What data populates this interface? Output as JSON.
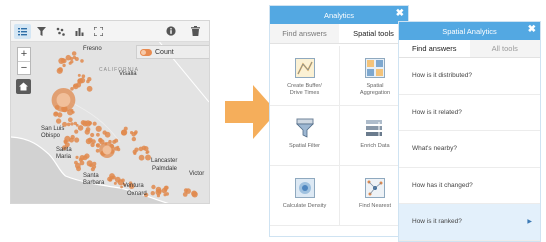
{
  "map": {
    "toolbar_icons": [
      "list-icon",
      "filter-icon",
      "scatter-icon",
      "bar-chart-icon",
      "fullscreen-icon",
      "info-icon",
      "trash-icon"
    ],
    "zoom_in": "+",
    "zoom_out": "−",
    "legend_label": "Count",
    "legend_chevron": "›",
    "cities": {
      "fresno": "Fresno",
      "visalia": "Visalia",
      "california": "CALIFORNIA",
      "san_luis_obispo": "San Luis\nObispo",
      "santa_maria": "Santa\nMaria",
      "lancaster": "Lancaster",
      "palmdale": "Palmdale",
      "santa_barbara": "Santa\nBarbara",
      "victor": "Victor",
      "ventura": "Ventura",
      "oxnard": "Oxnard"
    },
    "colors": {
      "point": "#e08a4e",
      "land": "#e4e4e4"
    }
  },
  "analytics": {
    "title": "Analytics",
    "close": "✖",
    "tabs": [
      "Find answers",
      "Spatial tools"
    ],
    "tools": [
      {
        "label": "Create Buffer/\nDrive Times",
        "icon": "buffer-icon"
      },
      {
        "label": "Spatial\nAggregation",
        "icon": "aggregation-icon"
      },
      {
        "label": "Spatial Filter",
        "icon": "spatial-filter-icon"
      },
      {
        "label": "Enrich Data",
        "icon": "enrich-icon"
      },
      {
        "label": "Calculate Density",
        "icon": "density-icon"
      },
      {
        "label": "Find Nearest",
        "icon": "nearest-icon"
      }
    ]
  },
  "spatial_analytics": {
    "title": "Spatial Analytics",
    "close": "✖",
    "tabs": [
      "Find answers",
      "All tools"
    ],
    "questions": [
      "How is it distributed?",
      "How is it related?",
      "What's nearby?",
      "How has it changed?",
      "How is it ranked?"
    ],
    "highlight_index": 4,
    "accent": "#53a8e2"
  }
}
